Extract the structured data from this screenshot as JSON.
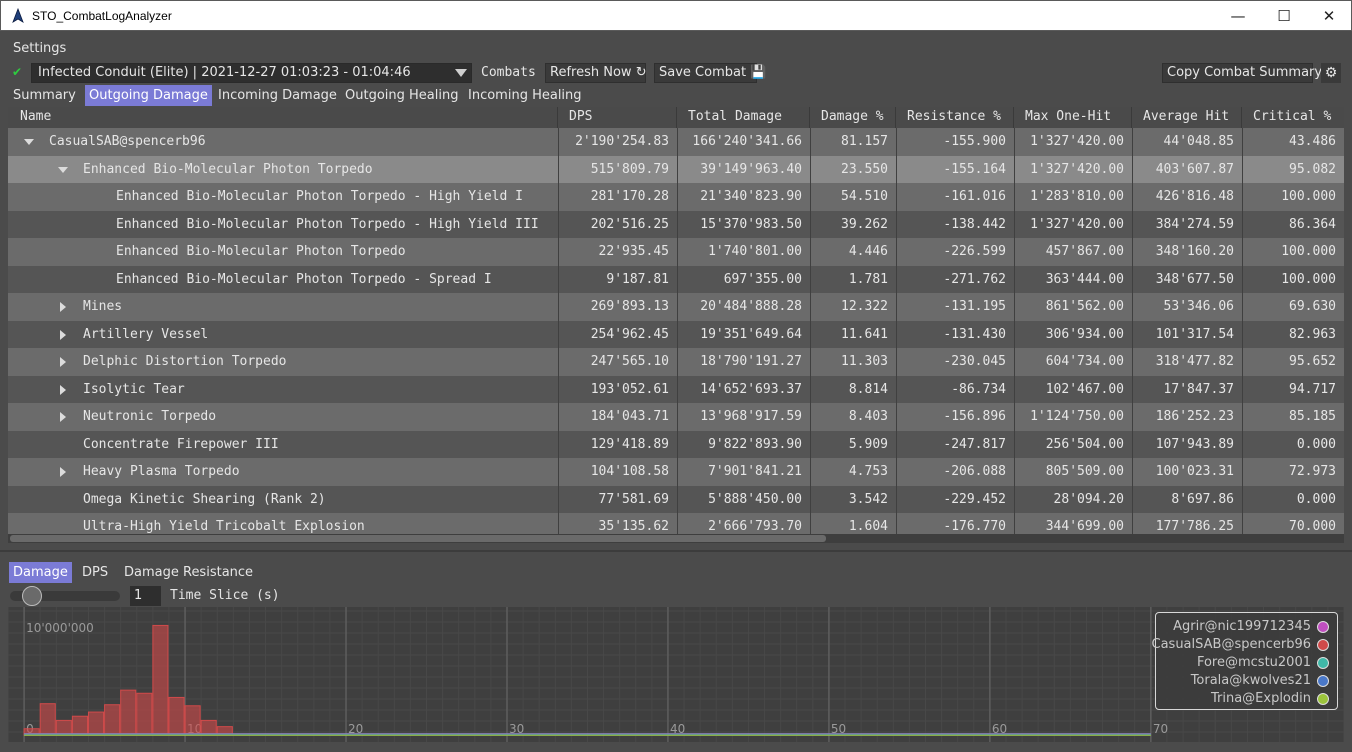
{
  "window": {
    "title": "STO_CombatLogAnalyzer",
    "minimize": "—",
    "maximize": "☐",
    "close": "✕"
  },
  "menu": {
    "settings": "Settings"
  },
  "combat_bar": {
    "status_icon": "check-icon",
    "selected_combat": "Infected Conduit (Elite) | 2021-12-27 01:03:23 - 01:04:46",
    "combats_label": "Combats",
    "refresh_label": "Refresh Now",
    "save_label": "Save Combat",
    "copy_summary_label": "Copy Combat Summary",
    "settings_icon": "gear-icon"
  },
  "tabs": [
    {
      "label": "Summary",
      "active": false
    },
    {
      "label": "Outgoing Damage",
      "active": true
    },
    {
      "label": "Incoming Damage",
      "active": false
    },
    {
      "label": "Outgoing Healing",
      "active": false
    },
    {
      "label": "Incoming Healing",
      "active": false
    }
  ],
  "table": {
    "columns": [
      "Name",
      "DPS",
      "Total Damage",
      "Damage %",
      "Resistance %",
      "Max One-Hit",
      "Average Hit",
      "Critical %"
    ],
    "rows": [
      {
        "name": "CasualSAB@spencerb96",
        "expander": "down",
        "level": 0,
        "values": [
          "2'190'254.83",
          "166'240'341.66",
          "81.157",
          "-155.900",
          "1'327'420.00",
          "44'048.85",
          "43.486"
        ]
      },
      {
        "name": "Enhanced Bio-Molecular Photon Torpedo",
        "expander": "down",
        "level": 1,
        "selected": true,
        "values": [
          "515'809.79",
          "39'149'963.40",
          "23.550",
          "-155.164",
          "1'327'420.00",
          "403'607.87",
          "95.082"
        ]
      },
      {
        "name": "Enhanced Bio-Molecular Photon Torpedo - High Yield I",
        "expander": "none",
        "level": 2,
        "values": [
          "281'170.28",
          "21'340'823.90",
          "54.510",
          "-161.016",
          "1'283'810.00",
          "426'816.48",
          "100.000"
        ]
      },
      {
        "name": "Enhanced Bio-Molecular Photon Torpedo - High Yield III",
        "expander": "none",
        "level": 2,
        "values": [
          "202'516.25",
          "15'370'983.50",
          "39.262",
          "-138.442",
          "1'327'420.00",
          "384'274.59",
          "86.364"
        ]
      },
      {
        "name": "Enhanced Bio-Molecular Photon Torpedo",
        "expander": "none",
        "level": 2,
        "values": [
          "22'935.45",
          "1'740'801.00",
          "4.446",
          "-226.599",
          "457'867.00",
          "348'160.20",
          "100.000"
        ]
      },
      {
        "name": "Enhanced Bio-Molecular Photon Torpedo - Spread I",
        "expander": "none",
        "level": 2,
        "values": [
          "9'187.81",
          "697'355.00",
          "1.781",
          "-271.762",
          "363'444.00",
          "348'677.50",
          "100.000"
        ]
      },
      {
        "name": "Mines",
        "expander": "right",
        "level": 1,
        "values": [
          "269'893.13",
          "20'484'888.28",
          "12.322",
          "-131.195",
          "861'562.00",
          "53'346.06",
          "69.630"
        ]
      },
      {
        "name": "Artillery Vessel",
        "expander": "right",
        "level": 1,
        "values": [
          "254'962.45",
          "19'351'649.64",
          "11.641",
          "-131.430",
          "306'934.00",
          "101'317.54",
          "82.963"
        ]
      },
      {
        "name": "Delphic Distortion Torpedo",
        "expander": "right",
        "level": 1,
        "values": [
          "247'565.10",
          "18'790'191.27",
          "11.303",
          "-230.045",
          "604'734.00",
          "318'477.82",
          "95.652"
        ]
      },
      {
        "name": "Isolytic Tear",
        "expander": "right",
        "level": 1,
        "values": [
          "193'052.61",
          "14'652'693.37",
          "8.814",
          "-86.734",
          "102'467.00",
          "17'847.37",
          "94.717"
        ]
      },
      {
        "name": "Neutronic Torpedo",
        "expander": "right",
        "level": 1,
        "values": [
          "184'043.71",
          "13'968'917.59",
          "8.403",
          "-156.896",
          "1'124'750.00",
          "186'252.23",
          "85.185"
        ]
      },
      {
        "name": "Concentrate Firepower III",
        "expander": "none",
        "level": 1,
        "values": [
          "129'418.89",
          "9'822'893.90",
          "5.909",
          "-247.817",
          "256'504.00",
          "107'943.89",
          "0.000"
        ]
      },
      {
        "name": "Heavy Plasma Torpedo",
        "expander": "right",
        "level": 1,
        "values": [
          "104'108.58",
          "7'901'841.21",
          "4.753",
          "-206.088",
          "805'509.00",
          "100'023.31",
          "72.973"
        ]
      },
      {
        "name": "Omega Kinetic Shearing (Rank 2)",
        "expander": "none",
        "level": 1,
        "values": [
          "77'581.69",
          "5'888'450.00",
          "3.542",
          "-229.452",
          "28'094.20",
          "8'697.86",
          "0.000"
        ]
      },
      {
        "name": "Ultra-High Yield Tricobalt Explosion",
        "expander": "none",
        "level": 1,
        "values": [
          "35'135.62",
          "2'666'793.70",
          "1.604",
          "-176.770",
          "344'699.00",
          "177'786.25",
          "70.000"
        ]
      }
    ]
  },
  "graph_tabs": [
    {
      "label": "Damage",
      "active": true
    },
    {
      "label": "DPS",
      "active": false
    },
    {
      "label": "Damage Resistance",
      "active": false
    }
  ],
  "time_slice": {
    "value": "1",
    "label": "Time Slice (s)"
  },
  "chart_data": {
    "type": "bar",
    "ylabel_tick": "10'000'000",
    "x_ticks": [
      "0",
      "10",
      "20",
      "30",
      "40",
      "50",
      "60",
      "70"
    ],
    "xlim": [
      -1,
      82
    ],
    "ylim": [
      0,
      11500000
    ],
    "legend_position": "top-right",
    "series": [
      {
        "name": "Agrir@nic199712345",
        "color": "#c04fc0"
      },
      {
        "name": "CasualSAB@spencerb96",
        "color": "#d04a4a",
        "x_start": 0,
        "values": [
          600000,
          3000000,
          1400000,
          1800000,
          2200000,
          2900000,
          4300000,
          4000000,
          10500000,
          3600000,
          2800000,
          1400000,
          800000,
          0,
          0,
          0,
          0,
          0,
          0,
          0,
          0,
          0,
          0,
          0,
          0,
          0,
          0,
          0,
          0,
          0,
          0,
          0,
          0,
          0,
          0,
          0,
          0,
          0,
          0,
          0,
          0,
          0,
          0,
          0,
          0,
          0,
          0,
          0,
          0,
          0,
          0,
          0,
          0,
          0,
          0,
          0,
          0,
          0,
          0,
          0,
          0,
          0,
          0,
          0,
          0,
          0,
          0,
          0,
          0,
          0,
          0,
          0,
          0,
          0,
          0,
          0,
          0,
          0,
          0,
          0,
          0,
          0,
          0
        ]
      },
      {
        "name": "Fore@mcstu2001",
        "color": "#3fb8a8"
      },
      {
        "name": "Torala@kwolves21",
        "color": "#4a78c8"
      },
      {
        "name": "Trina@Explodin",
        "color": "#9cc43c"
      }
    ]
  }
}
